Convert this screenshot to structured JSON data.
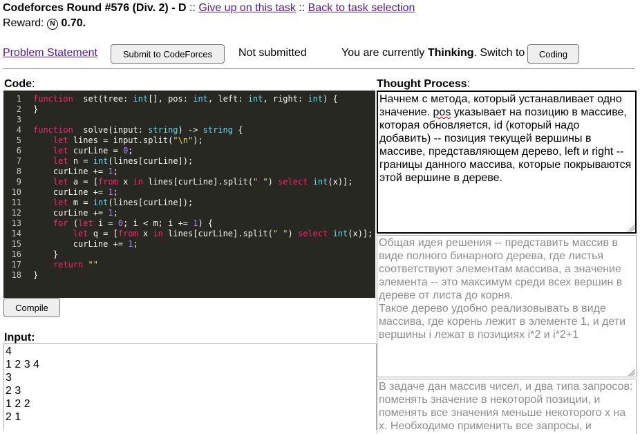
{
  "header": {
    "title": "Codeforces Round #576 (Div. 2) - D",
    "sep": "::",
    "give_up": "Give up on this task",
    "back": "Back to task selection",
    "reward_label": "Reward:",
    "reward_badge": "N",
    "reward_value": "0.70."
  },
  "toolbar": {
    "problem_statement": "Problem Statement",
    "submit_label": "Submit to CodeForces",
    "status": "Not submitted",
    "mode_prefix": "You are currently",
    "mode_value": "Thinking",
    "mode_suffix": ". Switch to",
    "switch_label": "Coding"
  },
  "code_section": {
    "label": "Code",
    "colon": ":",
    "compile_label": "Compile",
    "lines": [
      [
        [
          "kw",
          "function"
        ],
        [
          "",
          "  set(tree: "
        ],
        [
          "ty",
          "int"
        ],
        [
          "",
          "[], pos: "
        ],
        [
          "ty",
          "int"
        ],
        [
          "",
          ", left: "
        ],
        [
          "ty",
          "int"
        ],
        [
          "",
          ", right: "
        ],
        [
          "ty",
          "int"
        ],
        [
          "",
          ") {"
        ]
      ],
      [
        [
          "",
          "}"
        ]
      ],
      [],
      [
        [
          "kw",
          "function"
        ],
        [
          "",
          "  solve(input: "
        ],
        [
          "ty",
          "string"
        ],
        [
          "",
          ") -> "
        ],
        [
          "ty",
          "string"
        ],
        [
          "",
          " {"
        ]
      ],
      [
        [
          "",
          "    "
        ],
        [
          "kw",
          "let"
        ],
        [
          "",
          " lines = input.split("
        ],
        [
          "str",
          "\"\\n\""
        ],
        [
          "",
          ");"
        ]
      ],
      [
        [
          "",
          "    "
        ],
        [
          "kw",
          "let"
        ],
        [
          "",
          " curLine = "
        ],
        [
          "num",
          "0"
        ],
        [
          "",
          ";"
        ]
      ],
      [
        [
          "",
          "    "
        ],
        [
          "kw",
          "let"
        ],
        [
          "",
          " n = "
        ],
        [
          "ty",
          "int"
        ],
        [
          "",
          "(lines[curLine]);"
        ]
      ],
      [
        [
          "",
          "    curLine += "
        ],
        [
          "num",
          "1"
        ],
        [
          "",
          ";"
        ]
      ],
      [
        [
          "",
          "    "
        ],
        [
          "kw",
          "let"
        ],
        [
          "",
          " a = ["
        ],
        [
          "kw",
          "from"
        ],
        [
          "",
          " x "
        ],
        [
          "kw",
          "in"
        ],
        [
          "",
          " lines[curLine].split("
        ],
        [
          "str",
          "\" \""
        ],
        [
          "",
          ") "
        ],
        [
          "kw",
          "select"
        ],
        [
          "",
          " "
        ],
        [
          "ty",
          "int"
        ],
        [
          "",
          "(x)];"
        ]
      ],
      [
        [
          "",
          "    curLine += "
        ],
        [
          "num",
          "1"
        ],
        [
          "",
          ";"
        ]
      ],
      [
        [
          "",
          "    "
        ],
        [
          "kw",
          "let"
        ],
        [
          "",
          " m = "
        ],
        [
          "ty",
          "int"
        ],
        [
          "",
          "(lines[curLine]);"
        ]
      ],
      [
        [
          "",
          "    curLine += "
        ],
        [
          "num",
          "1"
        ],
        [
          "",
          ";"
        ]
      ],
      [
        [
          "",
          "    "
        ],
        [
          "kw",
          "for"
        ],
        [
          "",
          " ("
        ],
        [
          "kw",
          "let"
        ],
        [
          "",
          " i = "
        ],
        [
          "num",
          "0"
        ],
        [
          "",
          "; i < m; i += "
        ],
        [
          "num",
          "1"
        ],
        [
          "",
          ") {"
        ]
      ],
      [
        [
          "",
          "        "
        ],
        [
          "kw",
          "let"
        ],
        [
          "",
          " q = ["
        ],
        [
          "kw",
          "from"
        ],
        [
          "",
          " x "
        ],
        [
          "kw",
          "in"
        ],
        [
          "",
          " lines[curLine].split("
        ],
        [
          "str",
          "\" \""
        ],
        [
          "",
          ") "
        ],
        [
          "kw",
          "select"
        ],
        [
          "",
          " "
        ],
        [
          "ty",
          "int"
        ],
        [
          "",
          "(x)];"
        ]
      ],
      [
        [
          "",
          "        curLine += "
        ],
        [
          "num",
          "1"
        ],
        [
          "",
          ";"
        ]
      ],
      [
        [
          "",
          "    }"
        ]
      ],
      [
        [
          "",
          "    "
        ],
        [
          "kw",
          "return"
        ],
        [
          "",
          " "
        ],
        [
          "str",
          "\"\""
        ]
      ],
      [
        [
          "",
          "}"
        ]
      ]
    ]
  },
  "input_section": {
    "label": "Input:",
    "value": "4\n1 2 3 4\n3\n2 3\n1 2 2\n2 1"
  },
  "thought_section": {
    "label": "Thought Process",
    "colon": ":",
    "box1_before": "Начнем с метода, который устанавливает одно значение. ",
    "box1_marked": "pos",
    "box1_after": " указывает на позицию в массиве, которая обновляется, id (который надо добавить) -- позиция текущей вершины в массиве, представляющем дерево, left и right -- границы данного массива, которые покрываются этой вершине в дереве.",
    "box2_placeholder": "Общая идея решения -- представить массив в виде полного бинарного дерева, где листья соответствуют элементам массива, а значение элемента -- это максимум среди всех вершин в дереве от листа до корня.\nТакое дерево удобно реализовывать в виде массива, где корень лежит в элементе 1, и дети вершины i лежат в позициях i*2 и i*2+1",
    "box3_placeholder": "В задаче дан массив чисел, и два типа запросов: поменять значение в некоторой позиции, и поменять все значения меньше некоторого x на x. Необходимо применить все запросы, и"
  }
}
